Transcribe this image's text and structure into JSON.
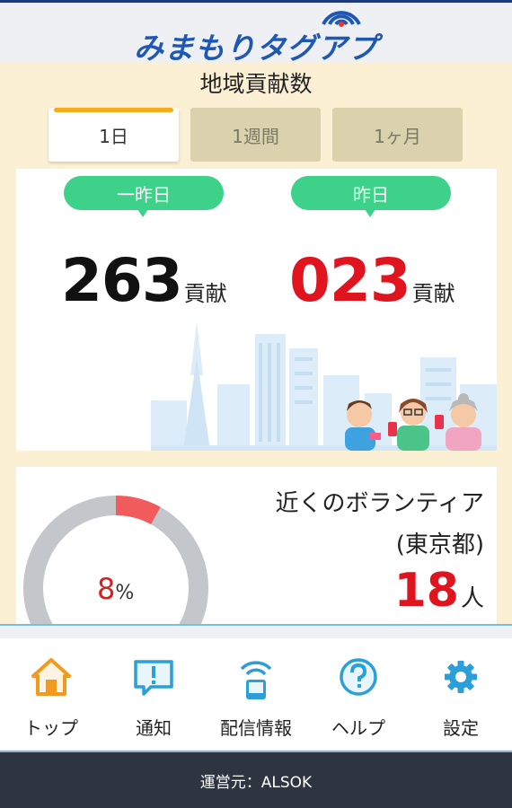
{
  "header": {
    "logo_text": "みまもりタグアプリ"
  },
  "main": {
    "title": "地域貢献数",
    "tabs": [
      {
        "label": "1日",
        "active": true
      },
      {
        "label": "1週間",
        "active": false
      },
      {
        "label": "1ヶ月",
        "active": false
      }
    ],
    "contributions": {
      "day_before_label": "一昨日",
      "day_before_value": "263",
      "yesterday_label": "昨日",
      "yesterday_value": "023",
      "unit": "貢献"
    },
    "volunteers": {
      "label_line1": "近くのボランティア",
      "label_line2": "(東京都)",
      "count": "18",
      "unit": "人",
      "percent_value": "8",
      "percent_sign": "%",
      "ratio": 0.08
    }
  },
  "nav": [
    {
      "label": "トップ",
      "icon": "home-icon"
    },
    {
      "label": "通知",
      "icon": "notification-icon"
    },
    {
      "label": "配信情報",
      "icon": "broadcast-icon"
    },
    {
      "label": "ヘルプ",
      "icon": "help-icon"
    },
    {
      "label": "設定",
      "icon": "settings-icon"
    }
  ],
  "footer": {
    "operator": "運営元：ALSOK"
  },
  "colors": {
    "accent_green": "#3dd189",
    "accent_red": "#e0141e",
    "tab_active": "#f2ac1c",
    "brand_blue": "#1f58b4"
  }
}
